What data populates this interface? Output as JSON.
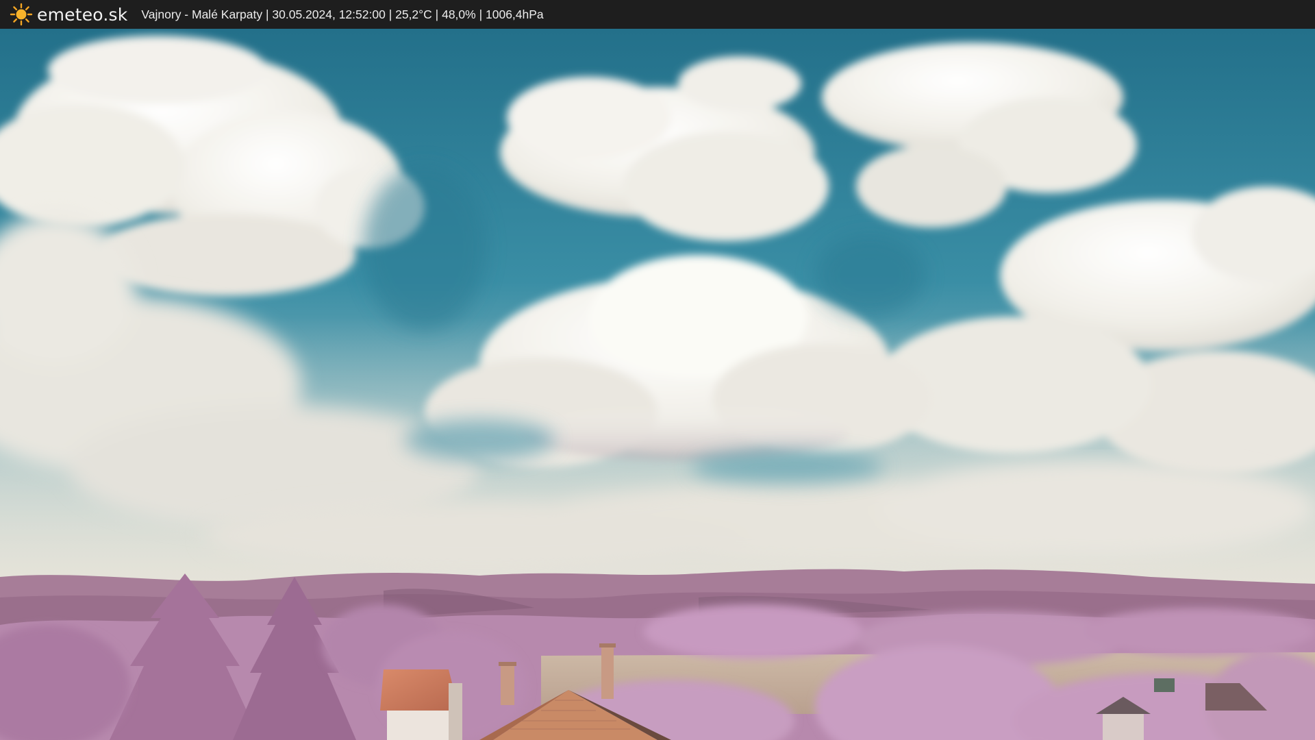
{
  "header": {
    "brand": "emeteo.sk",
    "station": "Vajnory - Malé Karpaty",
    "datetime": "30.05.2024, 12:52:00",
    "temperature": "25,2°C",
    "humidity": "48,0%",
    "pressure": "1006,4hPa",
    "separator": " | "
  },
  "icons": {
    "logo": "sun-icon"
  },
  "colors": {
    "bar_background": "#1e1e1e",
    "sky": "#2b7f95",
    "foliage": "#b07aa8",
    "roof": "#c9785e"
  }
}
